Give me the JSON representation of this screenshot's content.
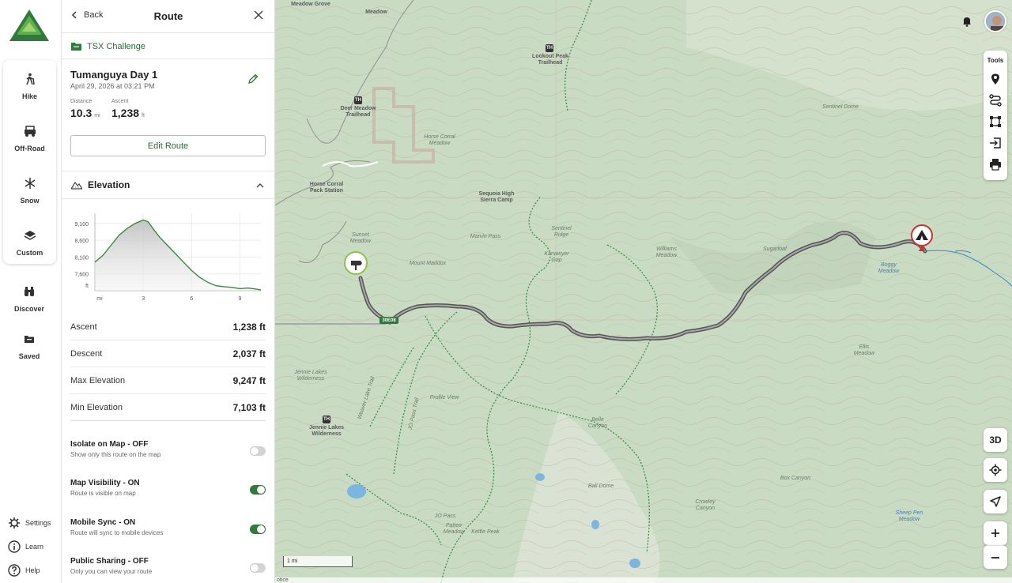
{
  "nav": {
    "modes": [
      {
        "label": "Hike",
        "icon": "hiker-icon"
      },
      {
        "label": "Off-Road",
        "icon": "jeep-icon"
      },
      {
        "label": "Snow",
        "icon": "snowflake-icon"
      },
      {
        "label": "Custom",
        "icon": "layers-icon"
      }
    ],
    "discover": "Discover",
    "saved": "Saved",
    "settings": "Settings",
    "learn": "Learn",
    "help": "Help"
  },
  "panel": {
    "back_label": "Back",
    "title": "Route",
    "folder": "TSX Challenge",
    "route_name": "Tumanguya Day 1",
    "route_date": "April 29, 2026 at 03:21 PM",
    "distance_label": "Distance",
    "distance_value": "10.3",
    "distance_unit": "mi",
    "ascent_label": "Ascent",
    "ascent_value": "1,238",
    "ascent_unit": "ft",
    "edit_button": "Edit Route",
    "elevation_title": "Elevation",
    "stats": [
      {
        "label": "Ascent",
        "value": "1,238 ft"
      },
      {
        "label": "Descent",
        "value": "2,037 ft"
      },
      {
        "label": "Max Elevation",
        "value": "9,247 ft"
      },
      {
        "label": "Min Elevation",
        "value": "7,103 ft"
      }
    ],
    "toggles": [
      {
        "title": "Isolate on Map - OFF",
        "desc": "Show only this route on the map",
        "on": false
      },
      {
        "title": "Map Visibility - ON",
        "desc": "Route is visible on map",
        "on": true
      },
      {
        "title": "Mobile Sync - ON",
        "desc": "Route will sync to mobile devices",
        "on": true
      },
      {
        "title": "Public Sharing - OFF",
        "desc": "Only you can view your route",
        "on": false
      }
    ]
  },
  "chart_data": {
    "type": "area",
    "x": [
      0,
      0.5,
      1,
      1.5,
      2,
      2.5,
      3,
      3.3,
      3.6,
      4,
      4.5,
      5,
      5.5,
      6,
      6.5,
      7,
      7.5,
      8,
      8.5,
      9,
      9.5,
      10,
      10.3
    ],
    "y": [
      7950,
      8150,
      8450,
      8750,
      8950,
      9100,
      9200,
      9150,
      8950,
      8700,
      8450,
      8200,
      7950,
      7700,
      7500,
      7350,
      7250,
      7220,
      7200,
      7160,
      7180,
      7150,
      7120
    ],
    "xlabel": "mi",
    "ylabel": "ft",
    "y_ticks": [
      "9,100",
      "8,600",
      "8,100",
      "7,600"
    ],
    "y_tick_values": [
      9100,
      8600,
      8100,
      7600
    ],
    "x_ticks": [
      "mi",
      "3",
      "6",
      "9"
    ],
    "x_tick_values": [
      0,
      3,
      6,
      9
    ],
    "xlim": [
      0,
      10.3
    ],
    "ylim": [
      7100,
      9400
    ],
    "line_color": "#3a8a3e"
  },
  "map": {
    "labels": {
      "meadow_grove": "Meadow Grove",
      "meadow": "Meadow",
      "lookout_peak": "Lookout Peak Trailhead",
      "deer_meadow": "Deer Meadow Trailhead",
      "horse_corral_meadow": "Horse Corral Meadow",
      "horse_corral_pack": "Horse Corral Pack Station",
      "sequoia_camp": "Sequoia High Sierra Camp",
      "sentinel_dome": "Sentinel Dome",
      "sunset_meadow": "Sunset Meadow",
      "marvin_pass": "Marvin Pass",
      "sentinel_ridge": "Sentinel Ridge",
      "mount_maddox": "Mount Maddox",
      "williams_meadow": "Williams Meadow",
      "sugarloaf": "Sugarloaf",
      "boggy_meadow": "Boggy Meadow",
      "kanawyer_gap": "Kanawyer Gap",
      "ellis_meadow": "Ellis Meadow",
      "jennie_lakes_wilderness": "Jennie Lakes Wilderness",
      "jennie_lakes_wilderness_th": "Jennie Lakes Wilderness",
      "weaver_lake_trail": "Weaver Lake Trail",
      "jo_pass_trail": "JO Pass Trail",
      "profile_view": "Profile View",
      "belle_canyon": "Belle Canyon",
      "box_canyon": "Box Canyon",
      "ball_dome": "Ball Dome",
      "crowley_canyon": "Crowley Canyon",
      "jo_pass": "JO Pass",
      "pattee_meadow": "Pattee Meadow",
      "kettle_peak": "Kettle Peak",
      "sheep_pen_meadow": "Sheep Pen Meadow",
      "road_30e08": "30E08",
      "th": "TH"
    },
    "tools_title": "Tools",
    "tools": [
      "waypoint-icon",
      "route-icon",
      "area-icon",
      "import-icon",
      "print-icon"
    ],
    "btn_3d": "3D",
    "scale": "1 mi",
    "notice": "otice",
    "accent": "#2f7a3c"
  }
}
